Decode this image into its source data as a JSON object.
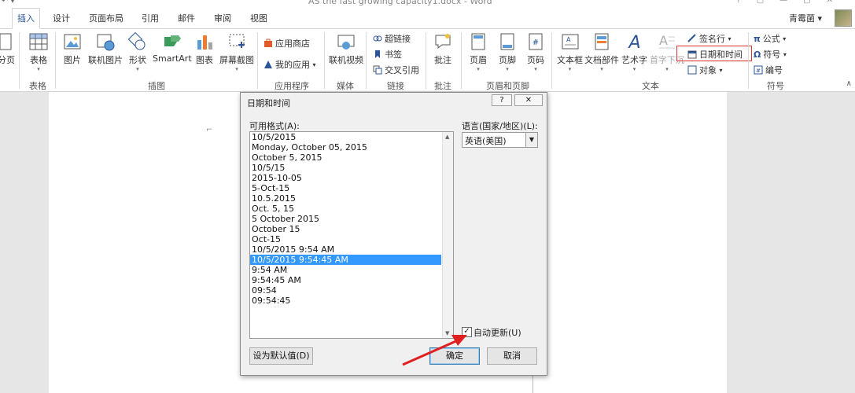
{
  "window": {
    "title": "AS the fast growing capacity1.docx - Word",
    "qat_icons": [
      "undo-icon",
      "customize-icon"
    ]
  },
  "tabs": [
    {
      "label": "插入",
      "active": true
    },
    {
      "label": "设计"
    },
    {
      "label": "页面布局"
    },
    {
      "label": "引用"
    },
    {
      "label": "邮件"
    },
    {
      "label": "审阅"
    },
    {
      "label": "视图"
    }
  ],
  "user": {
    "name": "青霉菌",
    "dropdown": "▾"
  },
  "ribbon": {
    "pages_btn": "分页",
    "tables": {
      "btn": "表格",
      "group": "表格"
    },
    "illustrations": {
      "picture": "图片",
      "online_picture": "联机图片",
      "shapes": "形状",
      "smartart": "SmartArt",
      "chart": "图表",
      "screenshot": "屏幕截图",
      "group": "插图"
    },
    "apps": {
      "store": "应用商店",
      "my_apps": "我的应用",
      "group": "应用程序"
    },
    "media": {
      "online_video": "联机视频",
      "group": "媒体"
    },
    "links": {
      "hyperlink": "超链接",
      "bookmark": "书签",
      "cross_ref": "交叉引用",
      "group": "链接"
    },
    "comments": {
      "comment": "批注",
      "group": "批注"
    },
    "header_footer": {
      "header": "页眉",
      "footer": "页脚",
      "page_number": "页码",
      "group": "页眉和页脚"
    },
    "text": {
      "textbox": "文本框",
      "quick_parts": "文档部件",
      "wordart": "艺术字",
      "dropcap": "首字下沉",
      "signature": "签名行",
      "datetime": "日期和时间",
      "object": "对象",
      "group": "文本"
    },
    "symbols": {
      "equation": "公式",
      "symbol": "符号",
      "numbering": "编号",
      "group": "符号"
    },
    "colors": {
      "accent": "#2b579a",
      "highlight": "#dd3333"
    }
  },
  "dialog": {
    "title": "日期和时间",
    "help": "?",
    "close": "✕",
    "formats_label": "可用格式(A):",
    "language_label": "语言(国家/地区)(L):",
    "language_value": "英语(美国)",
    "formats": [
      "10/5/2015",
      "Monday, October 05, 2015",
      "October 5, 2015",
      "10/5/15",
      "2015-10-05",
      "5-Oct-15",
      "10.5.2015",
      "Oct. 5, 15",
      "5 October 2015",
      "October 15",
      "Oct-15",
      "10/5/2015 9:54 AM",
      "10/5/2015 9:54:45 AM",
      "9:54 AM",
      "9:54:45 AM",
      "09:54",
      "09:54:45"
    ],
    "selected_index": 12,
    "auto_update_label": "自动更新(U)",
    "auto_update_checked": true,
    "set_default": "设为默认值(D)",
    "ok": "确定",
    "cancel": "取消",
    "annotation_color": "#e02020"
  }
}
